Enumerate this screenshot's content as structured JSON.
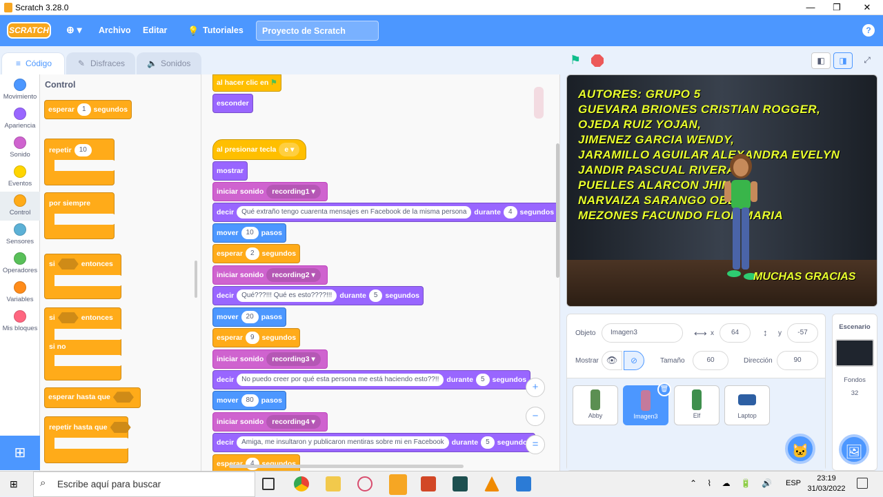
{
  "window": {
    "title": "Scratch 3.28.0",
    "minimize": "—",
    "maximize": "❐",
    "close": "✕"
  },
  "menubar": {
    "logo": "SCRATCH",
    "globe": "⊕ ▾",
    "file": "Archivo",
    "edit": "Editar",
    "tutorials": "Tutoriales",
    "project_title": "Proyecto de Scratch",
    "help": "?"
  },
  "tabs": {
    "code": "Código",
    "costumes": "Disfraces",
    "sounds": "Sonidos"
  },
  "categories": [
    {
      "label": "Movimiento",
      "color": "#4c97ff"
    },
    {
      "label": "Apariencia",
      "color": "#9966ff"
    },
    {
      "label": "Sonido",
      "color": "#cf63cf"
    },
    {
      "label": "Eventos",
      "color": "#ffd500"
    },
    {
      "label": "Control",
      "color": "#ffab19"
    },
    {
      "label": "Sensores",
      "color": "#5cb1d6"
    },
    {
      "label": "Operadores",
      "color": "#59c059"
    },
    {
      "label": "Variables",
      "color": "#ff8c1a"
    },
    {
      "label": "Mis bloques",
      "color": "#ff6680"
    }
  ],
  "palette": {
    "heading": "Control",
    "wait": {
      "label": "esperar",
      "value": "1",
      "suffix": "segundos"
    },
    "repeat": {
      "label": "repetir",
      "value": "10"
    },
    "forever": "por siempre",
    "if_then": {
      "if": "si",
      "then": "entonces"
    },
    "if_else": {
      "if": "si",
      "then": "entonces",
      "else": "si no"
    },
    "wait_until": "esperar hasta que",
    "repeat_until": "repetir hasta que"
  },
  "script": {
    "hat1": "al hacer clic en",
    "hide": "esconder",
    "hat2": {
      "label": "al presionar tecla",
      "key": "e"
    },
    "show": "mostrar",
    "sound1": {
      "label": "iniciar sonido",
      "value": "recording1"
    },
    "say1": {
      "label": "decir",
      "text": "Qué extraño tengo cuarenta mensajes en Facebook de la misma persona",
      "during": "durante",
      "secs": "4",
      "unit": "segundos"
    },
    "move1": {
      "label": "mover",
      "value": "10",
      "unit": "pasos"
    },
    "wait1": {
      "label": "esperar",
      "value": "2",
      "unit": "segundos"
    },
    "sound2": {
      "label": "iniciar sonido",
      "value": "recording2"
    },
    "say2": {
      "label": "decir",
      "text": "Qué???!!! Qué es esto????!!!",
      "during": "durante",
      "secs": "5",
      "unit": "segundos"
    },
    "move2": {
      "label": "mover",
      "value": "20",
      "unit": "pasos"
    },
    "wait2": {
      "label": "esperar",
      "value": "9",
      "unit": "segundos"
    },
    "sound3": {
      "label": "iniciar sonido",
      "value": "recording3"
    },
    "say3": {
      "label": "decir",
      "text": "No puedo creer por qué esta persona me está haciendo esto??!!",
      "during": "durante",
      "secs": "5",
      "unit": "segundos"
    },
    "move3": {
      "label": "mover",
      "value": "80",
      "unit": "pasos"
    },
    "sound4": {
      "label": "iniciar sonido",
      "value": "recording4"
    },
    "say4": {
      "label": "decir",
      "text": "Amiga, me insultaron y publicaron mentiras sobre mi en Facebook",
      "during": "durante",
      "secs": "5",
      "unit": "segundos"
    },
    "wait3": {
      "label": "esperar",
      "value": "4",
      "unit": "segundos"
    }
  },
  "stage_text": [
    "AUTORES: GRUPO 5",
    "GUEVARA BRIONES CRISTIAN ROGGER,",
    "OJEDA RUIZ YOJAN,",
    "JIMENEZ GARCIA WENDY,",
    "JARAMILLO AGUILAR ALEXANDRA EVELYN",
    "JANDIR PASCUAL RIVERA",
    "PUELLES ALARCON JHIN",
    "NARVAIZA SARANGO OBEN,",
    "MEZONES FACUNDO FLOR MARIA"
  ],
  "stage_thanks": "MUCHAS GRACIAS",
  "sprite_info": {
    "label_sprite": "Objeto",
    "name": "Imagen3",
    "label_x": "x",
    "x": "64",
    "label_y": "y",
    "y": "-57",
    "label_show": "Mostrar",
    "label_size": "Tamaño",
    "size": "60",
    "label_direction": "Dirección",
    "direction": "90"
  },
  "sprites": [
    {
      "name": "Abby",
      "color": "#5b8f52"
    },
    {
      "name": "Imagen3",
      "color": "#c47a9c"
    },
    {
      "name": "Elf",
      "color": "#3e8f4d"
    },
    {
      "name": "Laptop",
      "color": "#2d5fa3"
    }
  ],
  "stage_panel": {
    "title": "Escenario",
    "backdrops_label": "Fondos",
    "backdrops_count": "32"
  },
  "taskbar": {
    "search_placeholder": "Escribe aquí para buscar",
    "lang": "ESP",
    "time": "23:19",
    "date": "31/03/2022"
  }
}
